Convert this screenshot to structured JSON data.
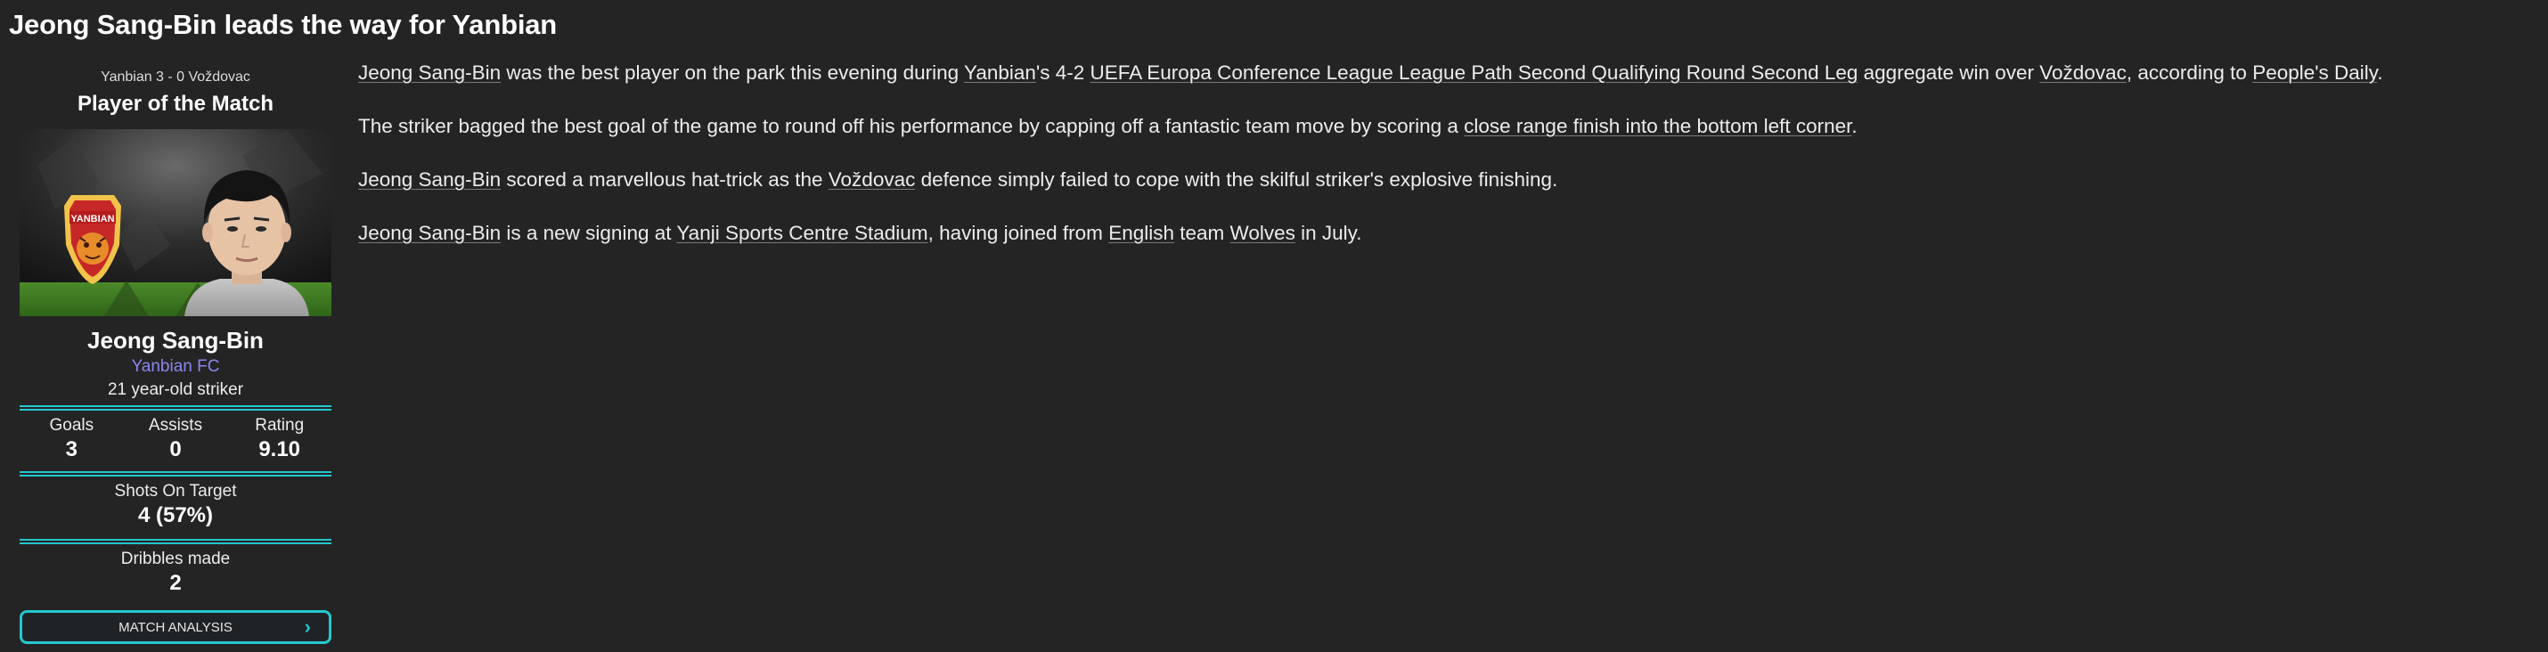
{
  "headline": "Jeong Sang-Bin leads the way for Yanbian",
  "panel": {
    "scoreline": "Yanbian 3 - 0 Voždovac",
    "title": "Player of the Match",
    "crest_text": "YANBIAN",
    "player_name": "Jeong Sang-Bin",
    "club": "Yanbian FC",
    "description": "21 year-old striker",
    "stats": [
      {
        "label": "Goals",
        "value": "3"
      },
      {
        "label": "Assists",
        "value": "0"
      },
      {
        "label": "Rating",
        "value": "9.10"
      }
    ],
    "shots": {
      "label": "Shots On Target",
      "value": "4 (57%)"
    },
    "dribbles": {
      "label": "Dribbles made",
      "value": "2"
    },
    "button_label": "MATCH ANALYSIS",
    "button_icon": "chevron-right-icon"
  },
  "article": {
    "p1": {
      "a": "Jeong Sang-Bin",
      "b": " was the best player on the park this evening during ",
      "c": "Yanbian",
      "d": "'s 4-2 ",
      "e": "UEFA Europa Conference League League Path Second Qualifying Round Second Leg",
      "f": " aggregate win over ",
      "g": "Voždovac",
      "h": ", according to ",
      "i": "People's Daily",
      "j": "."
    },
    "p2": {
      "a": "The striker bagged the best goal of the game to round off his performance by capping off a fantastic team move by scoring a ",
      "b": "close range finish into the bottom left corner",
      "c": "."
    },
    "p3": {
      "a": "Jeong Sang-Bin",
      "b": " scored a marvellous hat-trick as the ",
      "c": "Voždovac",
      "d": " defence simply failed to cope with the skilful striker's explosive finishing."
    },
    "p4": {
      "a": "Jeong Sang-Bin",
      "b": " is a new signing at ",
      "c": "Yanji Sports Centre Stadium",
      "d": ", having joined from ",
      "e": "English",
      "f": " team ",
      "g": "Wolves",
      "h": " in July."
    }
  },
  "colors": {
    "background": "#242424",
    "accent": "#25c7cf",
    "club_link": "#8b86ee",
    "crest_red": "#c62828"
  }
}
